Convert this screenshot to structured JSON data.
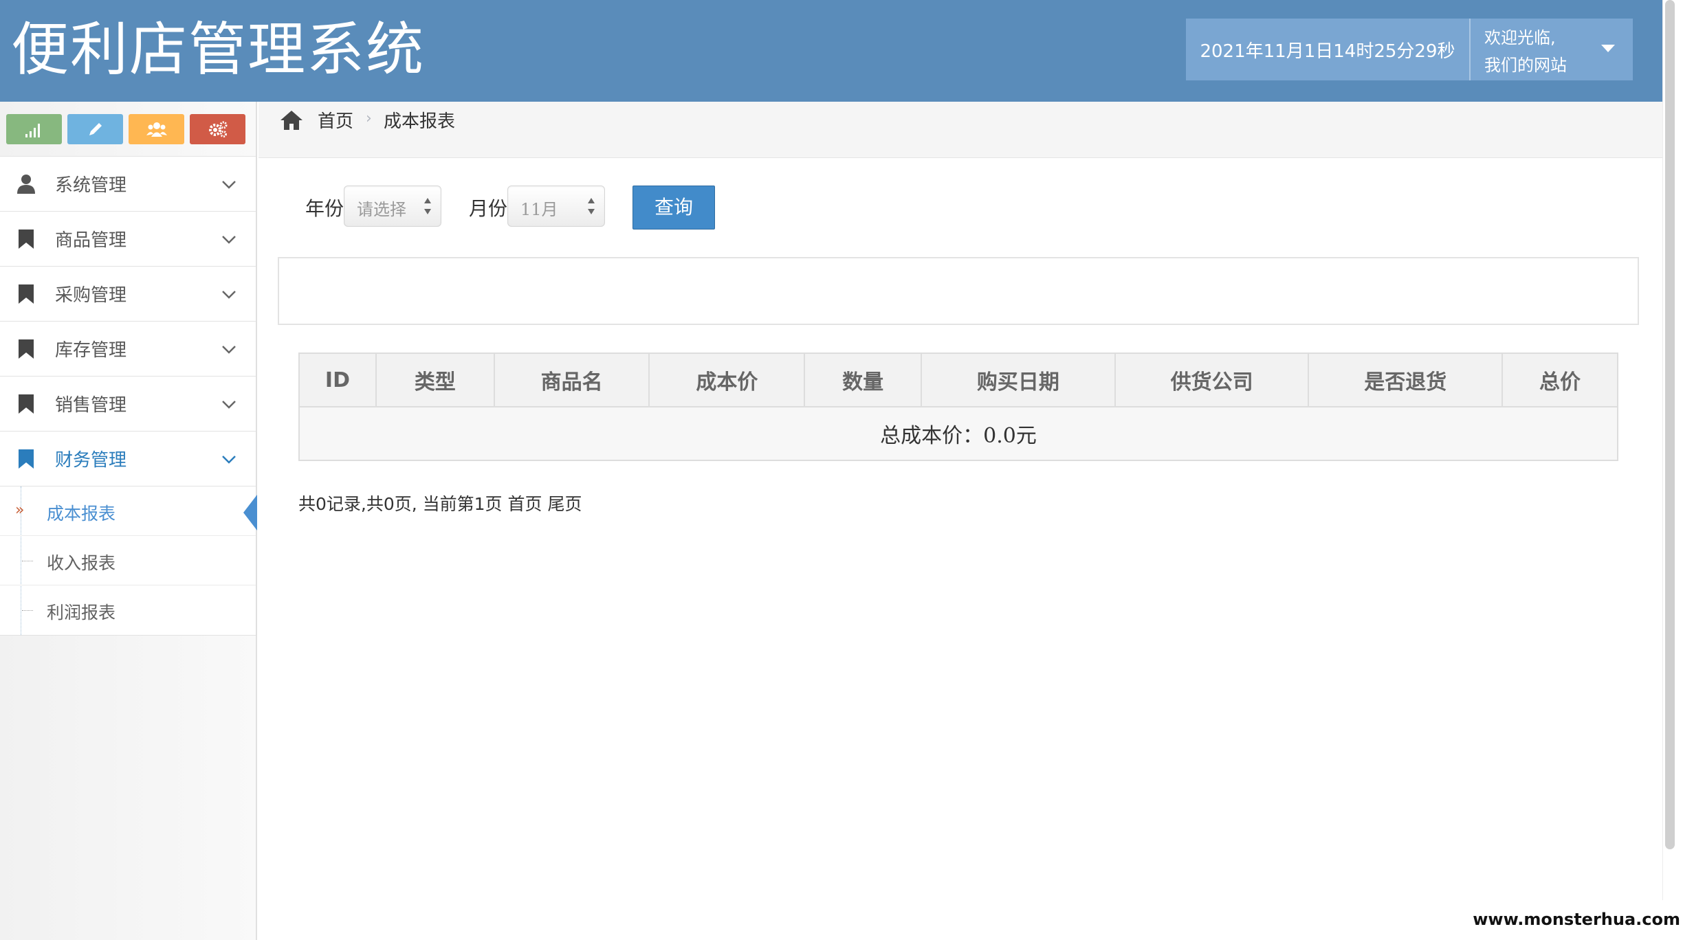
{
  "header": {
    "title": "便利店管理系统",
    "datetime": "2021年11月1日14时25分29秒",
    "welcome_line1": "欢迎光临,",
    "welcome_line2": "我们的网站"
  },
  "shortcuts": [
    {
      "icon": "signal-icon",
      "color": "#87b87f"
    },
    {
      "icon": "pencil-icon",
      "color": "#6fb3e0"
    },
    {
      "icon": "users-icon",
      "color": "#ffb752"
    },
    {
      "icon": "cogs-icon",
      "color": "#d15b47"
    }
  ],
  "sidebar": {
    "items": [
      {
        "label": "系统管理",
        "icon": "user-icon"
      },
      {
        "label": "商品管理",
        "icon": "bookmark-icon"
      },
      {
        "label": "采购管理",
        "icon": "bookmark-icon"
      },
      {
        "label": "库存管理",
        "icon": "bookmark-icon"
      },
      {
        "label": "销售管理",
        "icon": "bookmark-icon"
      },
      {
        "label": "财务管理",
        "icon": "bookmark-icon",
        "active": true
      }
    ],
    "submenu": [
      {
        "label": "成本报表",
        "active": true
      },
      {
        "label": "收入报表"
      },
      {
        "label": "利润报表"
      }
    ]
  },
  "breadcrumb": {
    "home": "首页",
    "current": "成本报表"
  },
  "filters": {
    "year_label": "年份",
    "year_value": "请选择",
    "month_label": "月份",
    "month_value": "11月",
    "query_button": "查询"
  },
  "table": {
    "columns": [
      "ID",
      "类型",
      "商品名",
      "成本价",
      "数量",
      "购买日期",
      "供货公司",
      "是否退货",
      "总价"
    ],
    "summary": "总成本价：0.0元"
  },
  "pagination": "共0记录,共0页, 当前第1页 首页 尾页",
  "watermark": "www.monsterhua.com",
  "colors": {
    "header_bg": "#5a8cba",
    "accent": "#428bca",
    "active_menu": "#2b7dbc"
  }
}
